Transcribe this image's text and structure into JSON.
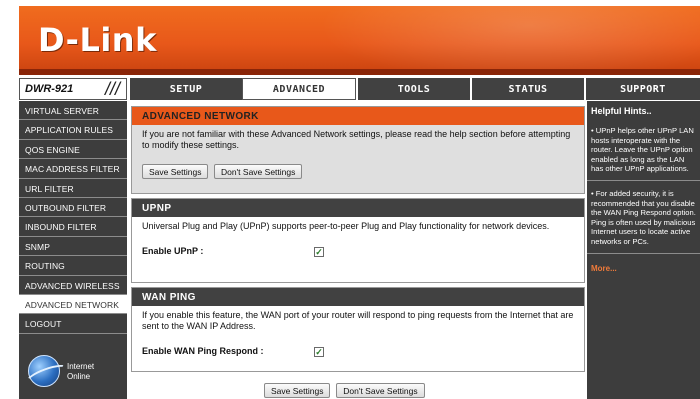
{
  "brand": {
    "logo": "D-Link",
    "model": "DWR-921",
    "slashes": "///"
  },
  "nav": {
    "tabs": [
      "SETUP",
      "ADVANCED",
      "TOOLS",
      "STATUS",
      "SUPPORT"
    ],
    "active": "ADVANCED"
  },
  "sidebar": {
    "items": [
      "VIRTUAL SERVER",
      "APPLICATION RULES",
      "QOS ENGINE",
      "MAC ADDRESS FILTER",
      "URL FILTER",
      "OUTBOUND FILTER",
      "INBOUND FILTER",
      "SNMP",
      "ROUTING",
      "ADVANCED WIRELESS",
      "ADVANCED NETWORK",
      "LOGOUT"
    ],
    "active": "ADVANCED NETWORK",
    "internet_status": {
      "line1": "Internet",
      "line2": "Online"
    }
  },
  "advanced_network": {
    "title": "ADVANCED NETWORK",
    "description": "If you are not familiar with these Advanced Network settings, please read the help section before attempting to modify these settings.",
    "save_label": "Save Settings",
    "dont_save_label": "Don't Save Settings"
  },
  "upnp": {
    "title": "UPNP",
    "description": "Universal Plug and Play (UPnP) supports peer-to-peer Plug and Play functionality for network devices.",
    "field_label": "Enable UPnP :",
    "checked": true
  },
  "wan_ping": {
    "title": "WAN PING",
    "description": "If you enable this feature, the WAN port of your router will respond to ping requests from the Internet that are sent to the WAN IP Address.",
    "field_label": "Enable WAN Ping Respond :",
    "checked": true
  },
  "footer": {
    "save_label": "Save Settings",
    "dont_save_label": "Don't Save Settings"
  },
  "help": {
    "title": "Helpful Hints..",
    "hint1": "• UPnP helps other UPnP LAN hosts interoperate with the router. Leave the UPnP option enabled as long as the LAN has other UPnP applications.",
    "hint2": "• For added security, it is recommended that you disable the WAN Ping Respond option. Ping is often used by malicious Internet users to locate active networks or PCs.",
    "more": "More..."
  },
  "colors": {
    "brand_orange": "#e8581a",
    "nav_dark": "#414141",
    "sidebar_dark": "#3d3d3d"
  }
}
